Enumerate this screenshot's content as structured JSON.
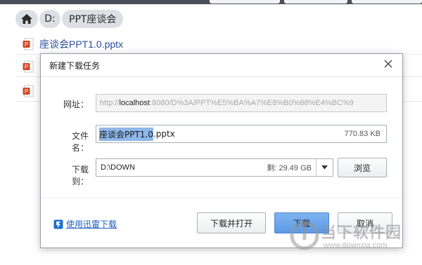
{
  "breadcrumb": {
    "drive": "D:",
    "folder": "PPT座谈会"
  },
  "files": [
    {
      "name": "座谈会PPT1.0.pptx"
    },
    {
      "name": ""
    },
    {
      "name": ""
    }
  ],
  "dialog": {
    "title": "新建下载任务",
    "url_label": "网址：",
    "url_prefix": "http://",
    "url_host": "localhost",
    "url_rest": ":8080/D%3A/PPT%E5%BA%A7%E8%B0%88%E4%BC%9",
    "filename_label": "文件名：",
    "filename_selected": "座谈会PPT1.0",
    "filename_ext": ".pptx",
    "filesize": "770.83 KB",
    "saveto_label": "下载到：",
    "save_path": "D:\\DOWN",
    "free_space": "剩: 29.49 GB",
    "browse_label": "浏览",
    "thunder_link": "使用迅雷下载",
    "download_open_label": "下载并打开",
    "download_label": "下载",
    "cancel_label": "取消"
  },
  "watermark": {
    "text": "当下软件园",
    "url": "www.downxia.com"
  },
  "colors": {
    "link": "#1f5fbf",
    "primary_button": "#6aa6ec",
    "breadcrumb_bg": "#dcdfe4",
    "selection": "#8fb7ea"
  }
}
